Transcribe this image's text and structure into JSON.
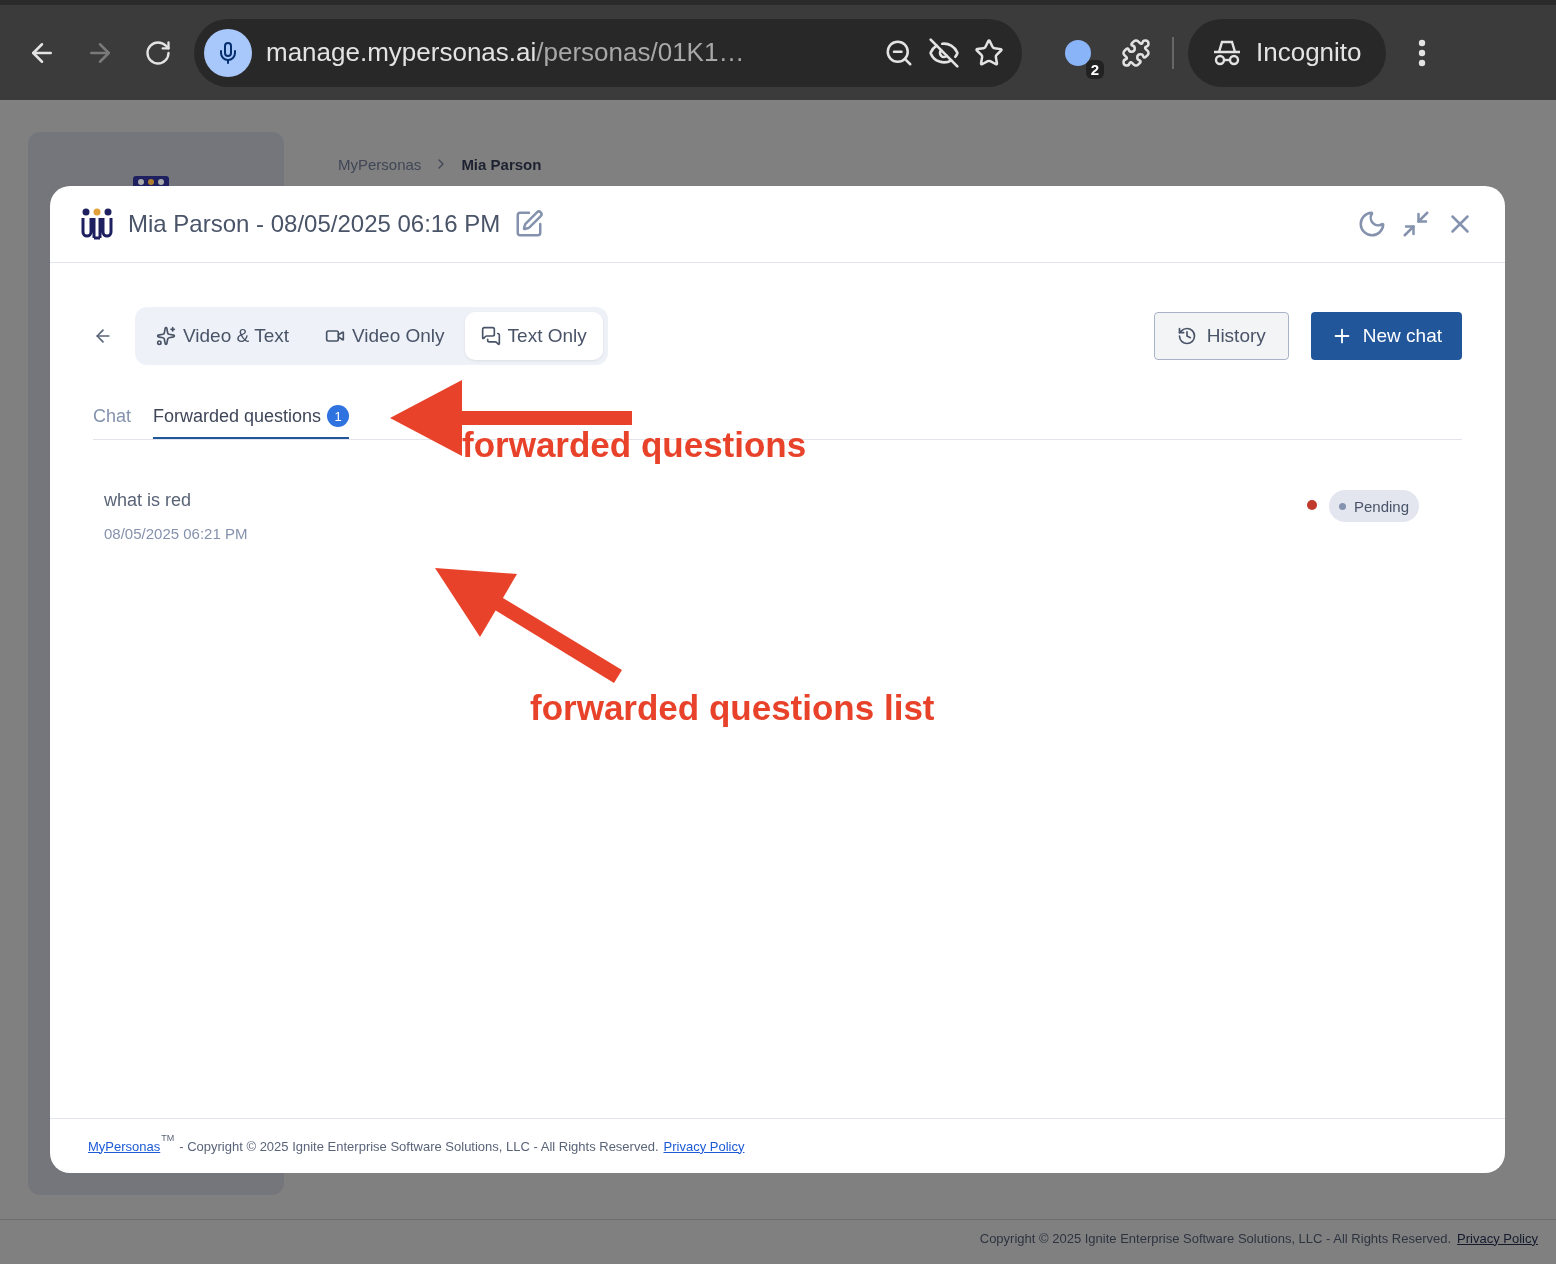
{
  "browser": {
    "url_host": "manage.mypersonas.ai",
    "url_path": "/personas/01K1…",
    "extension_badge": "2",
    "profile_label": "Incognito"
  },
  "page": {
    "breadcrumb": [
      {
        "label": "MyPersonas",
        "current": false
      },
      {
        "label": "Mia Parson",
        "current": true
      }
    ],
    "footer": {
      "text": "Copyright © 2025 Ignite Enterprise Software Solutions, LLC - All Rights Reserved.",
      "link": "Privacy Policy"
    }
  },
  "modal": {
    "title": "Mia Parson - 08/05/2025 06:16 PM",
    "modes": [
      {
        "label": "Video & Text",
        "kind": "sparkles",
        "selected": false
      },
      {
        "label": "Video Only",
        "kind": "video",
        "selected": false
      },
      {
        "label": "Text Only",
        "kind": "chat",
        "selected": true
      }
    ],
    "history_button": "History",
    "new_chat_button": "New chat",
    "tabs": [
      {
        "label": "Chat",
        "selected": false
      },
      {
        "label": "Forwarded questions",
        "badge": "1",
        "selected": true
      }
    ],
    "questions": [
      {
        "text": "what is red",
        "time": "08/05/2025 06:21 PM",
        "unread": true,
        "status": "Pending"
      }
    ],
    "footer": {
      "brand": "MyPersonas",
      "trademark": "TM",
      "text": "- Copyright © 2025 Ignite Enterprise Software Solutions, LLC - All Rights Reserved.",
      "link": "Privacy Policy"
    }
  },
  "annotations": [
    {
      "text": "forwarded questions",
      "kind": "left"
    },
    {
      "text": "forwarded questions list",
      "kind": "up-left"
    }
  ]
}
